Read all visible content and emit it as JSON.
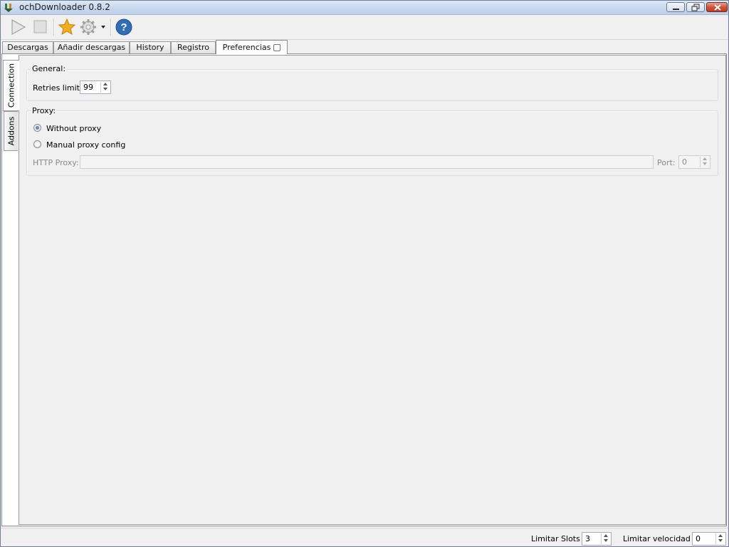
{
  "window": {
    "title": "ochDownloader 0.8.2",
    "buttons": [
      "minimize",
      "maximize",
      "close"
    ]
  },
  "toolbar": {
    "items": [
      {
        "icon": "play-icon"
      },
      {
        "icon": "stop-icon"
      },
      {
        "icon": "star-icon"
      },
      {
        "icon": "gear-icon"
      },
      {
        "icon": "help-icon"
      }
    ]
  },
  "tabs": [
    {
      "label": "Descargas"
    },
    {
      "label": "Añadir descargas"
    },
    {
      "label": "History"
    },
    {
      "label": "Registro"
    },
    {
      "label": "Preferencias",
      "active": true
    }
  ],
  "side_tabs": [
    {
      "label": "Connection",
      "active": true
    },
    {
      "label": "Addons"
    }
  ],
  "general": {
    "title": "General:",
    "retries_label": "Retries limit:",
    "retries_value": "99"
  },
  "proxy": {
    "title": "Proxy:",
    "without_label": "Without proxy",
    "manual_label": "Manual proxy config",
    "selected": "without",
    "http_label": "HTTP Proxy:",
    "http_value": "",
    "port_label": "Port:",
    "port_value": "0"
  },
  "statusbar": {
    "slots_label": "Limitar Slots",
    "slots_value": "3",
    "speed_label": "Limitar velocidad",
    "speed_value": "0"
  },
  "colors": {
    "accent": "#1f5f9c",
    "star": "#f2b01e",
    "help": "#2f6db5"
  }
}
